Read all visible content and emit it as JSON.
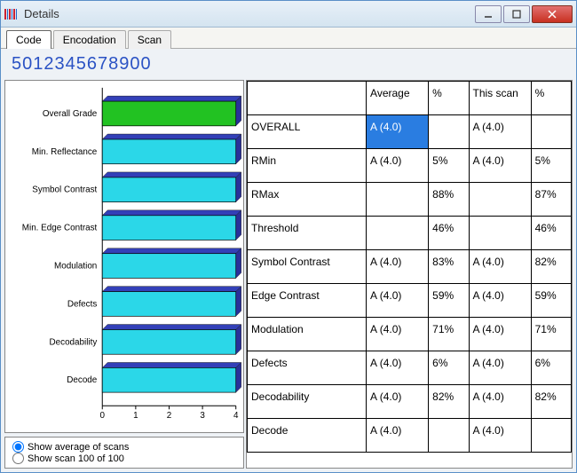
{
  "window": {
    "title": "Details"
  },
  "tabs": {
    "items": [
      "Code",
      "Encodation",
      "Scan"
    ],
    "active": 0
  },
  "barcode": "5012345678900",
  "headers": {
    "avg": "Average",
    "pct": "%",
    "scan": "This scan",
    "pct2": "%"
  },
  "rows": [
    {
      "name": "OVERALL",
      "avg": "A (4.0)",
      "pct": "",
      "scan": "A (4.0)",
      "pct2": "",
      "sel": true
    },
    {
      "name": "RMin",
      "avg": "A (4.0)",
      "pct": "5%",
      "scan": "A (4.0)",
      "pct2": "5%"
    },
    {
      "name": "RMax",
      "avg": "",
      "pct": "88%",
      "scan": "",
      "pct2": "87%"
    },
    {
      "name": "Threshold",
      "avg": "",
      "pct": "46%",
      "scan": "",
      "pct2": "46%"
    },
    {
      "name": "Symbol Contrast",
      "avg": "A (4.0)",
      "pct": "83%",
      "scan": "A (4.0)",
      "pct2": "82%"
    },
    {
      "name": "Edge Contrast",
      "avg": "A (4.0)",
      "pct": "59%",
      "scan": "A (4.0)",
      "pct2": "59%"
    },
    {
      "name": "Modulation",
      "avg": "A (4.0)",
      "pct": "71%",
      "scan": "A (4.0)",
      "pct2": "71%"
    },
    {
      "name": "Defects",
      "avg": "A (4.0)",
      "pct": "6%",
      "scan": "A (4.0)",
      "pct2": "6%"
    },
    {
      "name": "Decodability",
      "avg": "A (4.0)",
      "pct": "82%",
      "scan": "A (4.0)",
      "pct2": "82%"
    },
    {
      "name": "Decode",
      "avg": "A (4.0)",
      "pct": "",
      "scan": "A (4.0)",
      "pct2": ""
    }
  ],
  "radios": {
    "opt1": "Show average of scans",
    "opt2": "Show scan 100 of 100"
  },
  "chart_data": {
    "type": "bar",
    "orientation": "horizontal",
    "categories": [
      "Overall Grade",
      "Min. Reflectance",
      "Symbol Contrast",
      "Min. Edge Contrast",
      "Modulation",
      "Defects",
      "Decodability",
      "Decode"
    ],
    "values": [
      4,
      4,
      4,
      4,
      4,
      4,
      4,
      4
    ],
    "colors": [
      "#22c222",
      "#2bd7e8",
      "#2bd7e8",
      "#2bd7e8",
      "#2bd7e8",
      "#2bd7e8",
      "#2bd7e8",
      "#2bd7e8"
    ],
    "xlim": [
      0,
      4
    ],
    "xticks": [
      0,
      1,
      2,
      3,
      4
    ],
    "title": "",
    "xlabel": "",
    "ylabel": ""
  }
}
